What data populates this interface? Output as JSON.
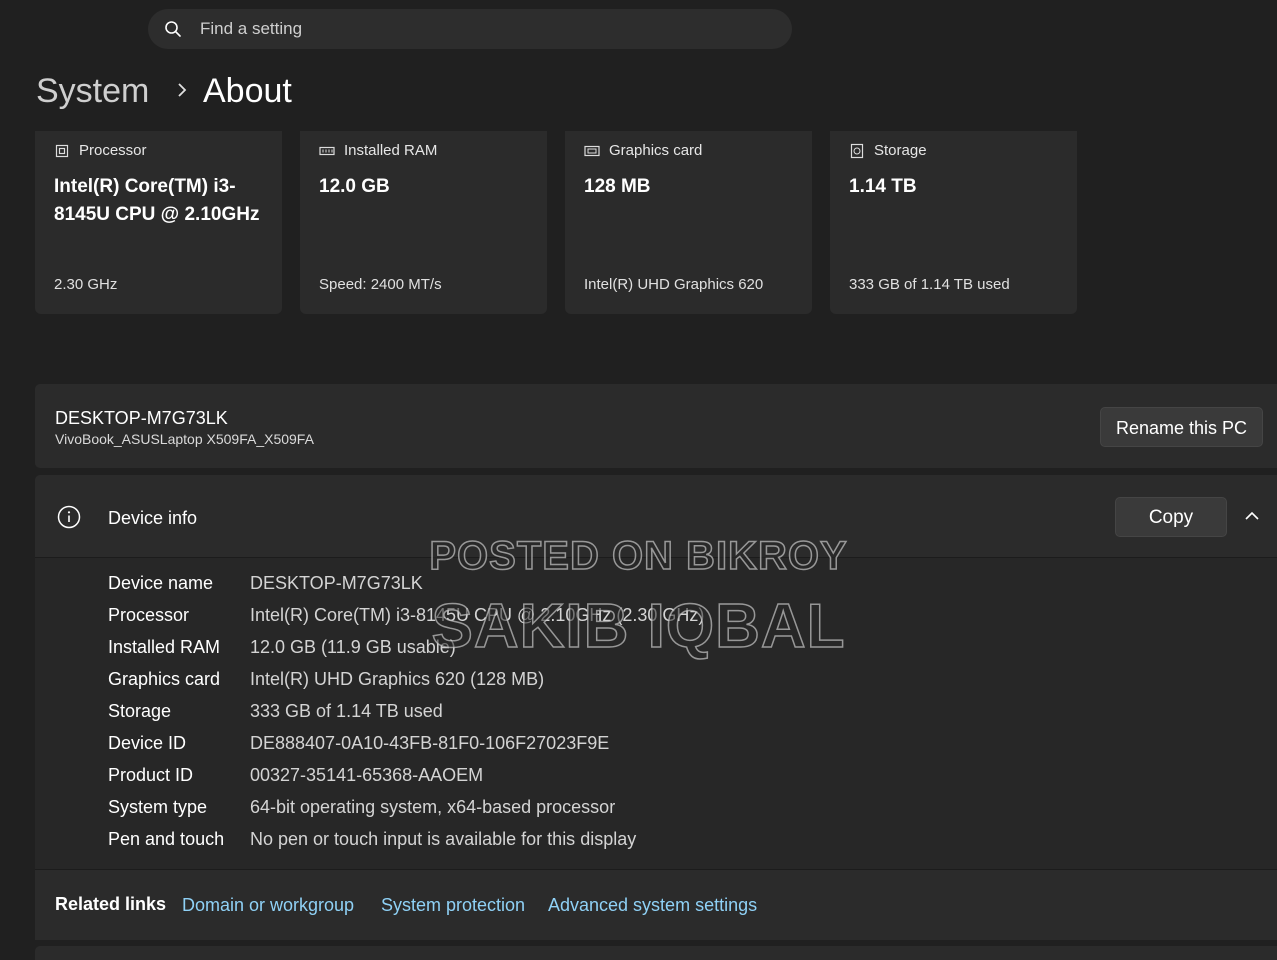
{
  "search": {
    "placeholder": "Find a setting",
    "icon": "search-icon"
  },
  "breadcrumb": {
    "parent": "System",
    "current": "About"
  },
  "specs": [
    {
      "label": "Processor",
      "icon": "processor-icon",
      "value": "Intel(R) Core(TM) i3-8145U CPU @ 2.10GHz",
      "sub": "2.30 GHz"
    },
    {
      "label": "Installed RAM",
      "icon": "ram-icon",
      "value": "12.0 GB",
      "sub": "Speed: 2400 MT/s"
    },
    {
      "label": "Graphics card",
      "icon": "graphics-card-icon",
      "value": "128 MB",
      "sub": "Intel(R) UHD Graphics 620"
    },
    {
      "label": "Storage",
      "icon": "storage-icon",
      "value": "1.14 TB",
      "sub": "333 GB of 1.14 TB used"
    }
  ],
  "pc": {
    "name": "DESKTOP-M7G73LK",
    "model": "VivoBook_ASUSLaptop X509FA_X509FA",
    "rename_label": "Rename this PC"
  },
  "device_info": {
    "title": "Device info",
    "copy_label": "Copy",
    "rows": [
      {
        "key": "Device name",
        "value": "DESKTOP-M7G73LK"
      },
      {
        "key": "Processor",
        "value": "Intel(R) Core(TM) i3-8145U CPU @ 2.10GHz (2.30 GHz)"
      },
      {
        "key": "Installed RAM",
        "value": "12.0 GB (11.9 GB usable)"
      },
      {
        "key": "Graphics card",
        "value": "Intel(R) UHD Graphics 620 (128 MB)"
      },
      {
        "key": "Storage",
        "value": "333 GB of 1.14 TB used"
      },
      {
        "key": "Device ID",
        "value": "DE888407-0A10-43FB-81F0-106F27023F9E"
      },
      {
        "key": "Product ID",
        "value": "00327-35141-65368-AAOEM"
      },
      {
        "key": "System type",
        "value": "64-bit operating system, x64-based processor"
      },
      {
        "key": "Pen and touch",
        "value": "No pen or touch input is available for this display"
      }
    ]
  },
  "related": {
    "label": "Related links",
    "links": [
      "Domain or workgroup",
      "System protection",
      "Advanced system settings"
    ]
  },
  "watermark": {
    "line1": "POSTED ON BIKROY",
    "line2": "SAKIB IQBAL"
  },
  "colors": {
    "background": "#202020",
    "card": "#2b2b2b",
    "link": "#8fd1f6"
  }
}
